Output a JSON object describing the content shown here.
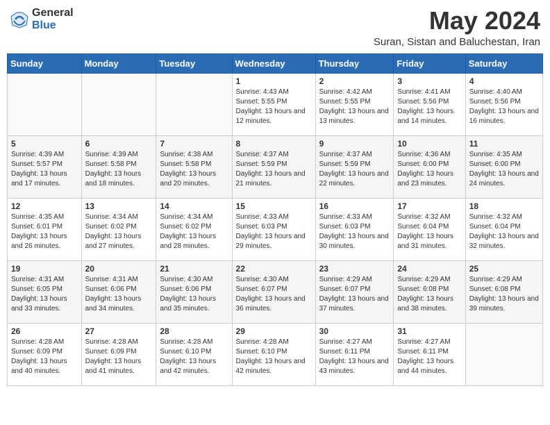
{
  "header": {
    "logo_general": "General",
    "logo_blue": "Blue",
    "month_year": "May 2024",
    "location": "Suran, Sistan and Baluchestan, Iran"
  },
  "days_of_week": [
    "Sunday",
    "Monday",
    "Tuesday",
    "Wednesday",
    "Thursday",
    "Friday",
    "Saturday"
  ],
  "weeks": [
    [
      {
        "day": "",
        "sunrise": "",
        "sunset": "",
        "daylight": ""
      },
      {
        "day": "",
        "sunrise": "",
        "sunset": "",
        "daylight": ""
      },
      {
        "day": "",
        "sunrise": "",
        "sunset": "",
        "daylight": ""
      },
      {
        "day": "1",
        "sunrise": "Sunrise: 4:43 AM",
        "sunset": "Sunset: 5:55 PM",
        "daylight": "Daylight: 13 hours and 12 minutes."
      },
      {
        "day": "2",
        "sunrise": "Sunrise: 4:42 AM",
        "sunset": "Sunset: 5:55 PM",
        "daylight": "Daylight: 13 hours and 13 minutes."
      },
      {
        "day": "3",
        "sunrise": "Sunrise: 4:41 AM",
        "sunset": "Sunset: 5:56 PM",
        "daylight": "Daylight: 13 hours and 14 minutes."
      },
      {
        "day": "4",
        "sunrise": "Sunrise: 4:40 AM",
        "sunset": "Sunset: 5:56 PM",
        "daylight": "Daylight: 13 hours and 16 minutes."
      }
    ],
    [
      {
        "day": "5",
        "sunrise": "Sunrise: 4:39 AM",
        "sunset": "Sunset: 5:57 PM",
        "daylight": "Daylight: 13 hours and 17 minutes."
      },
      {
        "day": "6",
        "sunrise": "Sunrise: 4:39 AM",
        "sunset": "Sunset: 5:58 PM",
        "daylight": "Daylight: 13 hours and 18 minutes."
      },
      {
        "day": "7",
        "sunrise": "Sunrise: 4:38 AM",
        "sunset": "Sunset: 5:58 PM",
        "daylight": "Daylight: 13 hours and 20 minutes."
      },
      {
        "day": "8",
        "sunrise": "Sunrise: 4:37 AM",
        "sunset": "Sunset: 5:59 PM",
        "daylight": "Daylight: 13 hours and 21 minutes."
      },
      {
        "day": "9",
        "sunrise": "Sunrise: 4:37 AM",
        "sunset": "Sunset: 5:59 PM",
        "daylight": "Daylight: 13 hours and 22 minutes."
      },
      {
        "day": "10",
        "sunrise": "Sunrise: 4:36 AM",
        "sunset": "Sunset: 6:00 PM",
        "daylight": "Daylight: 13 hours and 23 minutes."
      },
      {
        "day": "11",
        "sunrise": "Sunrise: 4:35 AM",
        "sunset": "Sunset: 6:00 PM",
        "daylight": "Daylight: 13 hours and 24 minutes."
      }
    ],
    [
      {
        "day": "12",
        "sunrise": "Sunrise: 4:35 AM",
        "sunset": "Sunset: 6:01 PM",
        "daylight": "Daylight: 13 hours and 26 minutes."
      },
      {
        "day": "13",
        "sunrise": "Sunrise: 4:34 AM",
        "sunset": "Sunset: 6:02 PM",
        "daylight": "Daylight: 13 hours and 27 minutes."
      },
      {
        "day": "14",
        "sunrise": "Sunrise: 4:34 AM",
        "sunset": "Sunset: 6:02 PM",
        "daylight": "Daylight: 13 hours and 28 minutes."
      },
      {
        "day": "15",
        "sunrise": "Sunrise: 4:33 AM",
        "sunset": "Sunset: 6:03 PM",
        "daylight": "Daylight: 13 hours and 29 minutes."
      },
      {
        "day": "16",
        "sunrise": "Sunrise: 4:33 AM",
        "sunset": "Sunset: 6:03 PM",
        "daylight": "Daylight: 13 hours and 30 minutes."
      },
      {
        "day": "17",
        "sunrise": "Sunrise: 4:32 AM",
        "sunset": "Sunset: 6:04 PM",
        "daylight": "Daylight: 13 hours and 31 minutes."
      },
      {
        "day": "18",
        "sunrise": "Sunrise: 4:32 AM",
        "sunset": "Sunset: 6:04 PM",
        "daylight": "Daylight: 13 hours and 32 minutes."
      }
    ],
    [
      {
        "day": "19",
        "sunrise": "Sunrise: 4:31 AM",
        "sunset": "Sunset: 6:05 PM",
        "daylight": "Daylight: 13 hours and 33 minutes."
      },
      {
        "day": "20",
        "sunrise": "Sunrise: 4:31 AM",
        "sunset": "Sunset: 6:06 PM",
        "daylight": "Daylight: 13 hours and 34 minutes."
      },
      {
        "day": "21",
        "sunrise": "Sunrise: 4:30 AM",
        "sunset": "Sunset: 6:06 PM",
        "daylight": "Daylight: 13 hours and 35 minutes."
      },
      {
        "day": "22",
        "sunrise": "Sunrise: 4:30 AM",
        "sunset": "Sunset: 6:07 PM",
        "daylight": "Daylight: 13 hours and 36 minutes."
      },
      {
        "day": "23",
        "sunrise": "Sunrise: 4:29 AM",
        "sunset": "Sunset: 6:07 PM",
        "daylight": "Daylight: 13 hours and 37 minutes."
      },
      {
        "day": "24",
        "sunrise": "Sunrise: 4:29 AM",
        "sunset": "Sunset: 6:08 PM",
        "daylight": "Daylight: 13 hours and 38 minutes."
      },
      {
        "day": "25",
        "sunrise": "Sunrise: 4:29 AM",
        "sunset": "Sunset: 6:08 PM",
        "daylight": "Daylight: 13 hours and 39 minutes."
      }
    ],
    [
      {
        "day": "26",
        "sunrise": "Sunrise: 4:28 AM",
        "sunset": "Sunset: 6:09 PM",
        "daylight": "Daylight: 13 hours and 40 minutes."
      },
      {
        "day": "27",
        "sunrise": "Sunrise: 4:28 AM",
        "sunset": "Sunset: 6:09 PM",
        "daylight": "Daylight: 13 hours and 41 minutes."
      },
      {
        "day": "28",
        "sunrise": "Sunrise: 4:28 AM",
        "sunset": "Sunset: 6:10 PM",
        "daylight": "Daylight: 13 hours and 42 minutes."
      },
      {
        "day": "29",
        "sunrise": "Sunrise: 4:28 AM",
        "sunset": "Sunset: 6:10 PM",
        "daylight": "Daylight: 13 hours and 42 minutes."
      },
      {
        "day": "30",
        "sunrise": "Sunrise: 4:27 AM",
        "sunset": "Sunset: 6:11 PM",
        "daylight": "Daylight: 13 hours and 43 minutes."
      },
      {
        "day": "31",
        "sunrise": "Sunrise: 4:27 AM",
        "sunset": "Sunset: 6:11 PM",
        "daylight": "Daylight: 13 hours and 44 minutes."
      },
      {
        "day": "",
        "sunrise": "",
        "sunset": "",
        "daylight": ""
      }
    ]
  ]
}
